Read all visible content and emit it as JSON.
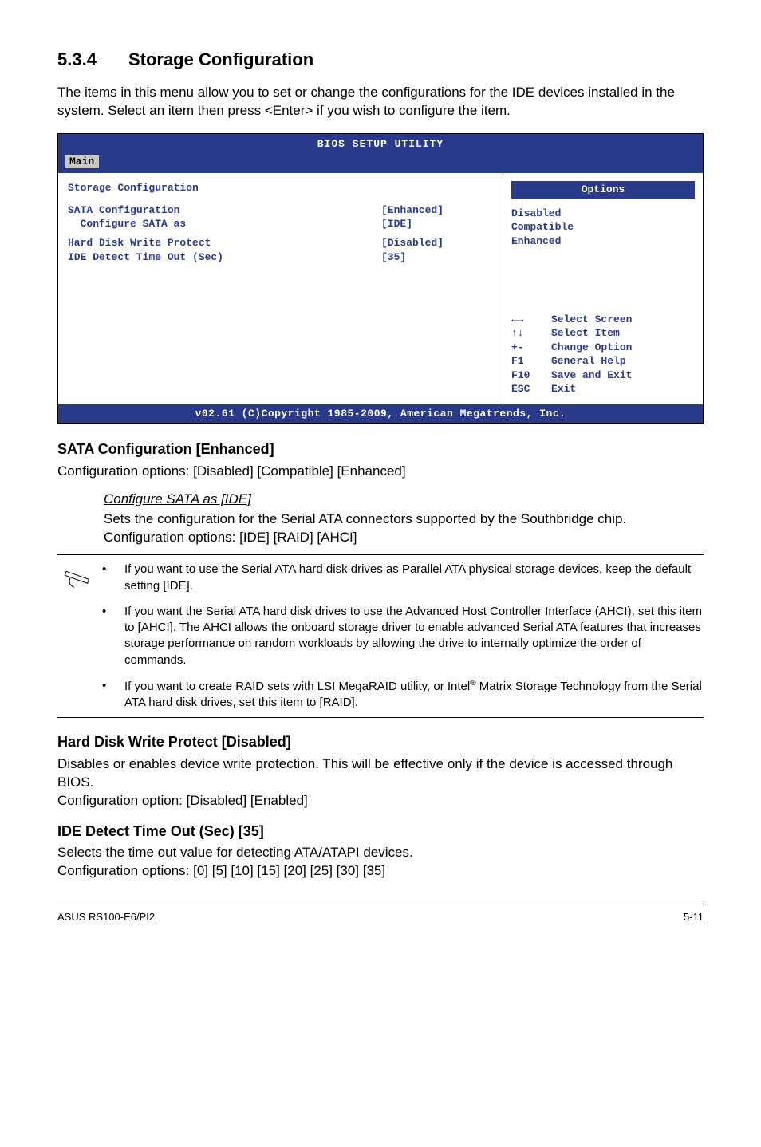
{
  "section": {
    "num": "5.3.4",
    "title": "Storage Configuration"
  },
  "intro": "The items in this menu allow you to set or change the configurations for the IDE devices installed in the system. Select an item then press <Enter> if you wish to configure the item.",
  "bios": {
    "title": "BIOS SETUP UTILITY",
    "tab": "Main",
    "left_header": "Storage Configuration",
    "rows": [
      {
        "label": "SATA Configuration",
        "value": "[Enhanced]"
      },
      {
        "label": "  Configure SATA as",
        "value": "[IDE]"
      },
      {
        "label": "Hard Disk Write Protect",
        "value": "[Disabled]"
      },
      {
        "label": "IDE Detect Time Out (Sec)",
        "value": "[35]"
      }
    ],
    "right_header": "Options",
    "options": [
      "Disabled",
      "Compatible",
      "Enhanced"
    ],
    "help": [
      {
        "key": "←→",
        "desc": "Select Screen"
      },
      {
        "key": "↑↓",
        "desc": "Select Item"
      },
      {
        "key": "+-",
        "desc": "Change Option"
      },
      {
        "key": "F1",
        "desc": "General Help"
      },
      {
        "key": "F10",
        "desc": "Save and Exit"
      },
      {
        "key": "ESC",
        "desc": "Exit"
      }
    ],
    "footer": "v02.61 (C)Copyright 1985-2009, American Megatrends, Inc."
  },
  "sata_conf": {
    "heading": "SATA Configuration [Enhanced]",
    "text": "Configuration options: [Disabled] [Compatible] [Enhanced]"
  },
  "configure_sata": {
    "heading": "Configure SATA as [IDE]",
    "text": "Sets the configuration for the Serial ATA connectors supported by the Southbridge chip. Configuration options: [IDE] [RAID] [AHCI]"
  },
  "notes": {
    "b1": "If you want to use the Serial ATA hard disk drives as Parallel ATA physical storage devices, keep the default setting [IDE].",
    "b2": "If you want the Serial ATA hard disk drives to use the Advanced Host Controller Interface (AHCI), set this item to [AHCI]. The AHCI allows the onboard storage driver to enable advanced Serial ATA features that increases storage performance on random workloads by allowing the drive to internally optimize the order of commands.",
    "b3a": "If you want to create RAID sets with LSI MegaRAID utility, or Intel",
    "b3b": " Matrix Storage Technology from the Serial ATA hard disk drives, set this item to [RAID]."
  },
  "hdwp": {
    "heading": "Hard Disk Write Protect [Disabled]",
    "text": "Disables or enables device write protection. This will be effective only if the device is accessed through BIOS.",
    "text2": "Configuration option: [Disabled] [Enabled]"
  },
  "ide": {
    "heading": "IDE Detect Time Out (Sec) [35]",
    "text": "Selects the time out value for detecting ATA/ATAPI devices.",
    "text2": "Configuration options: [0] [5] [10] [15] [20] [25] [30] [35]"
  },
  "footer": {
    "left": "ASUS RS100-E6/PI2",
    "right": "5-11"
  }
}
